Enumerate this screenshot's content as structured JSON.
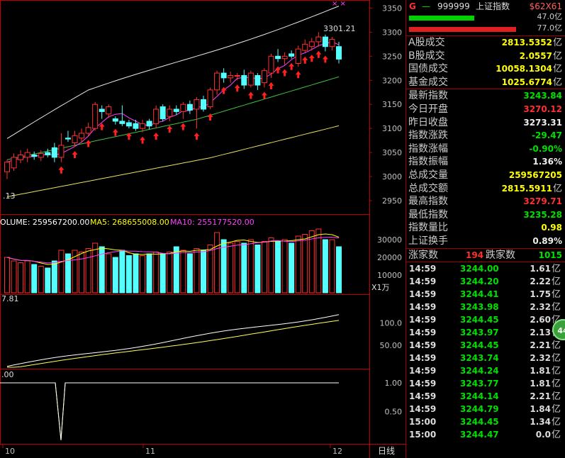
{
  "header": {
    "code": "999999",
    "name": "上证指数",
    "tag": "$62X61"
  },
  "ratio_bars": [
    {
      "pct_label": "47.0亿",
      "fill": 0.47,
      "color": "#00d000"
    },
    {
      "pct_label": "77.0亿",
      "fill": 0.77,
      "color": "#e02020"
    }
  ],
  "turnover": [
    {
      "label": "A股成交",
      "value": "2813.5352",
      "unit": "亿"
    },
    {
      "label": "B股成交",
      "value": "2.0557",
      "unit": "亿"
    },
    {
      "label": "国债成交",
      "value": "10058.1304",
      "unit": "亿"
    },
    {
      "label": "基金成交",
      "value": "1025.6774",
      "unit": "亿"
    }
  ],
  "stats": [
    {
      "label": "最新指数",
      "value": "3243.84",
      "color": "green"
    },
    {
      "label": "今日开盘",
      "value": "3270.12",
      "color": "red"
    },
    {
      "label": "昨日收盘",
      "value": "3273.31",
      "color": "white"
    },
    {
      "label": "指数涨跌",
      "value": "-29.47",
      "color": "green"
    },
    {
      "label": "指数涨幅",
      "value": "-0.90%",
      "color": "green"
    },
    {
      "label": "指数振幅",
      "value": "1.36%",
      "color": "white"
    },
    {
      "label": "总成交量",
      "value": "259567205",
      "color": "yellow"
    },
    {
      "label": "总成交额",
      "value": "2815.5911",
      "unit": "亿",
      "color": "yellow"
    },
    {
      "label": "最高指数",
      "value": "3279.71",
      "color": "red"
    },
    {
      "label": "最低指数",
      "value": "3235.28",
      "color": "green"
    },
    {
      "label": "指数量比",
      "value": "0.98",
      "color": "yellow"
    },
    {
      "label": "上证换手",
      "value": "0.89%",
      "color": "white"
    }
  ],
  "updown": {
    "up_label": "涨家数",
    "up": "194",
    "down_label": "跌家数",
    "down": "1015"
  },
  "ticks": [
    {
      "time": "14:59",
      "price": "3244.00",
      "vol": "1.61"
    },
    {
      "time": "14:59",
      "price": "3244.20",
      "vol": "2.22"
    },
    {
      "time": "14:59",
      "price": "3244.41",
      "vol": "1.75"
    },
    {
      "time": "14:59",
      "price": "3243.98",
      "vol": "2.32"
    },
    {
      "time": "14:59",
      "price": "3244.45",
      "vol": "2.60"
    },
    {
      "time": "14:59",
      "price": "3243.97",
      "vol": "2.13"
    },
    {
      "time": "14:59",
      "price": "3244.45",
      "vol": "2.21"
    },
    {
      "time": "14:59",
      "price": "3243.74",
      "vol": "2.32"
    },
    {
      "time": "14:59",
      "price": "3244.24",
      "vol": "1.81"
    },
    {
      "time": "14:59",
      "price": "3243.77",
      "vol": "1.81"
    },
    {
      "time": "14:59",
      "price": "3244.14",
      "vol": "2.21"
    },
    {
      "time": "14:59",
      "price": "3244.79",
      "vol": "1.84"
    },
    {
      "time": "15:00",
      "price": "3244.45",
      "vol": "1.34"
    },
    {
      "time": "15:00",
      "price": "3244.47",
      "vol": "0.0"
    }
  ],
  "tick_unit": "亿",
  "float_badge": "44",
  "chart": {
    "price_axis": [
      "3350",
      "3300",
      "3250",
      "3200",
      "3150",
      "3100",
      "3050",
      "3000",
      "2950"
    ],
    "price_min": 2925,
    "price_max": 3355,
    "high_label": "3301.21",
    "low_label": ".13",
    "volume_legend": {
      "volume": "OLUME: 259567200.00",
      "ma5": "MA5: 268655008.00",
      "ma10": "MA10: 255177520.00"
    },
    "volume_axis": [
      "30000",
      "20000",
      "10000"
    ],
    "volume_unit": "X1万",
    "ind1_left": "7.81",
    "ind1_axis": [
      "100.0",
      "50.00"
    ],
    "ind2_left": ".00",
    "ind2_axis": [
      "1.00",
      "0.50"
    ],
    "date_labels": [
      "10",
      "11",
      "12"
    ],
    "period": "日线"
  },
  "chart_data": {
    "type": "candlestick",
    "candles": [
      [
        3010,
        3030,
        2995,
        3035
      ],
      [
        3018,
        3040,
        3012,
        3048
      ],
      [
        3035,
        3045,
        3028,
        3055
      ],
      [
        3040,
        3050,
        3030,
        3058
      ],
      [
        3045,
        3042,
        3035,
        3052
      ],
      [
        3040,
        3048,
        3032,
        3055
      ],
      [
        3050,
        3045,
        3040,
        3058
      ],
      [
        3060,
        3040,
        3030,
        3070
      ],
      [
        3040,
        3065,
        3030,
        3090
      ],
      [
        3080,
        3078,
        3072,
        3095
      ],
      [
        3070,
        3085,
        3062,
        3095
      ],
      [
        3080,
        3090,
        3070,
        3100
      ],
      [
        3090,
        3102,
        3085,
        3112
      ],
      [
        3100,
        3150,
        3095,
        3155
      ],
      [
        3140,
        3135,
        3120,
        3148
      ],
      [
        3130,
        3145,
        3122,
        3150
      ],
      [
        3120,
        3115,
        3108,
        3125
      ],
      [
        3115,
        3110,
        3105,
        3148
      ],
      [
        3112,
        3105,
        3100,
        3118
      ],
      [
        3110,
        3100,
        3095,
        3118
      ],
      [
        3100,
        3110,
        3092,
        3118
      ],
      [
        3115,
        3105,
        3098,
        3120
      ],
      [
        3110,
        3140,
        3100,
        3148
      ],
      [
        3145,
        3120,
        3115,
        3150
      ],
      [
        3125,
        3140,
        3115,
        3148
      ],
      [
        3140,
        3135,
        3128,
        3148
      ],
      [
        3135,
        3150,
        3120,
        3155
      ],
      [
        3150,
        3138,
        3130,
        3158
      ],
      [
        3140,
        3160,
        3100,
        3165
      ],
      [
        3160,
        3140,
        3135,
        3168
      ],
      [
        3145,
        3180,
        3140,
        3185
      ],
      [
        3180,
        3215,
        3170,
        3220
      ],
      [
        3215,
        3205,
        3195,
        3225
      ],
      [
        3205,
        3210,
        3195,
        3218
      ],
      [
        3210,
        3210,
        3200,
        3215
      ],
      [
        3210,
        3190,
        3182,
        3222
      ],
      [
        3190,
        3215,
        3185,
        3220
      ],
      [
        3210,
        3190,
        3180,
        3215
      ],
      [
        3195,
        3220,
        3185,
        3225
      ],
      [
        3215,
        3250,
        3205,
        3255
      ],
      [
        3250,
        3245,
        3238,
        3265
      ],
      [
        3245,
        3250,
        3232,
        3258
      ],
      [
        3255,
        3250,
        3245,
        3262
      ],
      [
        3235,
        3265,
        3228,
        3272
      ],
      [
        3262,
        3275,
        3258,
        3285
      ],
      [
        3270,
        3280,
        3262,
        3288
      ],
      [
        3280,
        3290,
        3270,
        3300
      ],
      [
        3290,
        3270,
        3260,
        3295
      ],
      [
        3270,
        3285,
        3262,
        3290
      ],
      [
        3270,
        3244,
        3235,
        3280
      ]
    ],
    "volume": [
      20,
      18,
      17,
      18,
      16,
      15,
      14,
      18,
      24,
      22,
      24,
      23,
      25,
      28,
      26,
      22,
      20,
      24,
      21,
      22,
      21,
      22,
      23,
      22,
      23,
      26,
      24,
      22,
      25,
      24,
      27,
      34,
      30,
      28,
      29,
      28,
      30,
      27,
      29,
      31,
      29,
      30,
      28,
      32,
      33,
      35,
      36,
      30,
      30,
      26
    ]
  }
}
